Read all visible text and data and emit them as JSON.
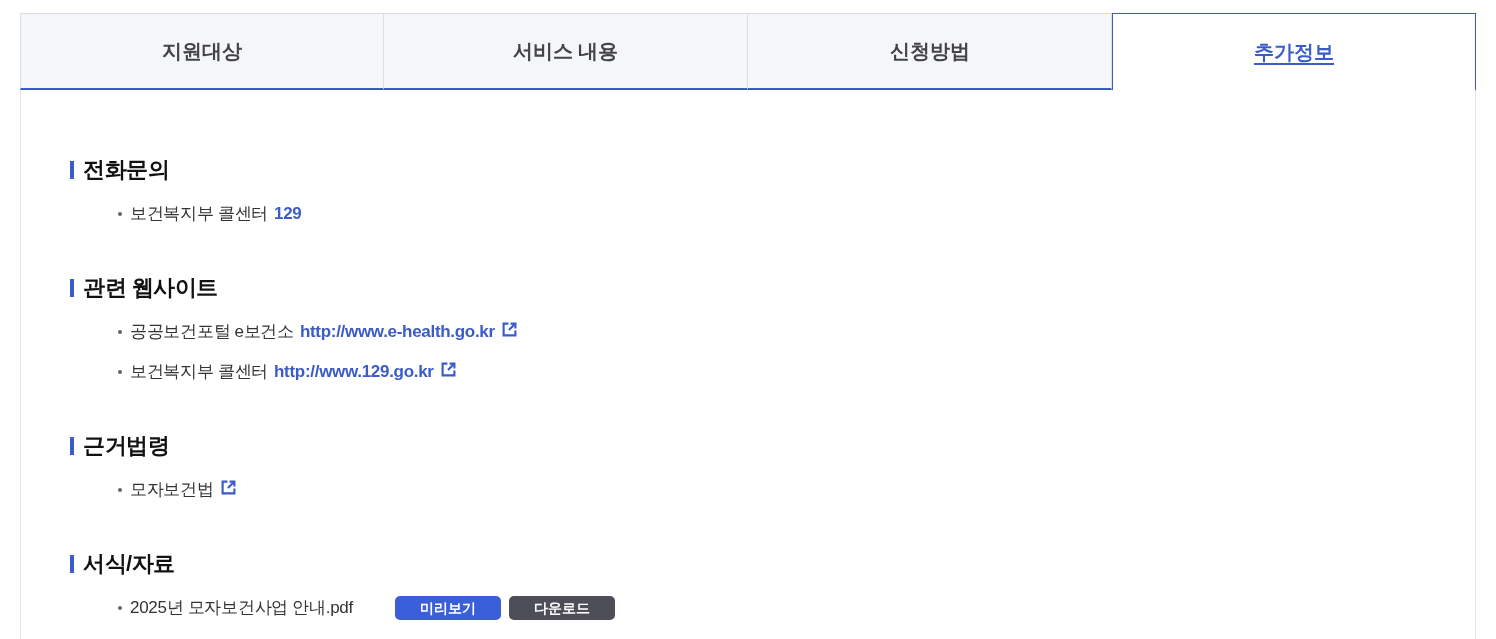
{
  "tabs": [
    {
      "label": "지원대상",
      "selected": false
    },
    {
      "label": "서비스 내용",
      "selected": false
    },
    {
      "label": "신청방법",
      "selected": false
    },
    {
      "label": "추가정보",
      "selected": true
    }
  ],
  "sections": [
    {
      "heading": "전화문의",
      "items": [
        {
          "text": "보건복지부 콜센터",
          "link": "129",
          "external_link": false
        }
      ]
    },
    {
      "heading": "관련 웹사이트",
      "items": [
        {
          "text": "공공보건포털 e보건소",
          "link": "http://www.e-health.go.kr",
          "external_link": true
        },
        {
          "text": "보건복지부 콜센터",
          "link": "http://www.129.go.kr",
          "external_link": true
        }
      ]
    },
    {
      "heading": "근거법령",
      "items": [
        {
          "text": "모자보건법",
          "external_link": true
        }
      ]
    },
    {
      "heading": "서식/자료",
      "items": [
        {
          "text": "2025년 모자보건사업 안내.pdf",
          "external_link": false,
          "buttons": [
            {
              "label": "미리보기",
              "kind": "preview"
            },
            {
              "label": "다운로드",
              "kind": "download"
            }
          ]
        }
      ]
    }
  ]
}
